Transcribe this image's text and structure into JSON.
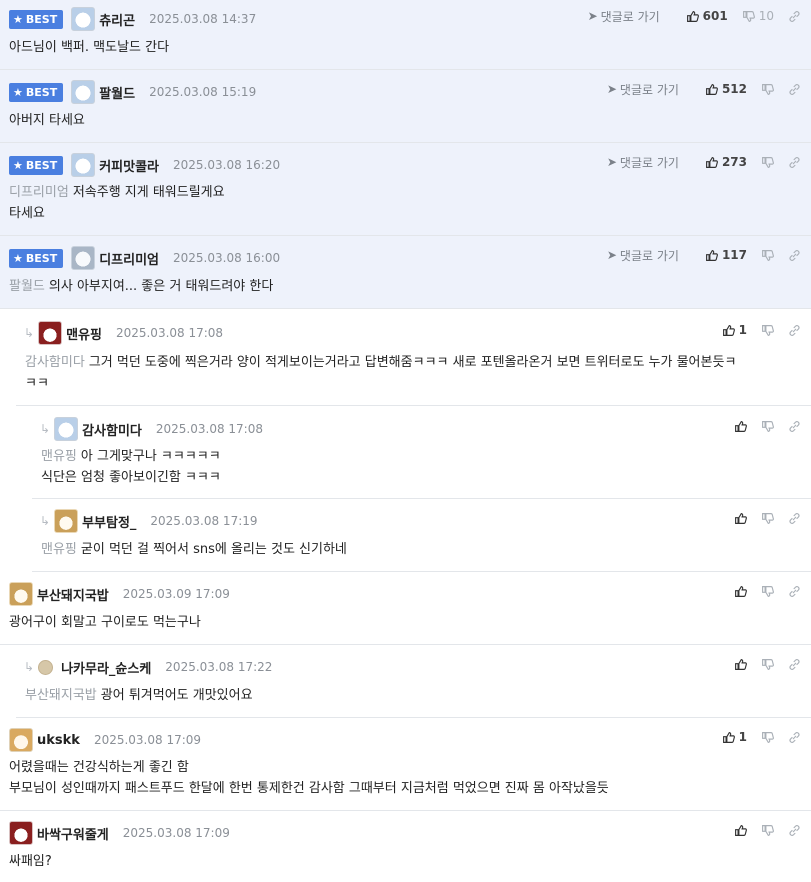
{
  "labels": {
    "best": "BEST",
    "goto": "댓글로 가기"
  },
  "comments": [
    {
      "nick": "츄리곤",
      "date": "2025.03.08 14:37",
      "likes": "601",
      "dislikes": "10",
      "text": "아드님이 백퍼. 맥도날드 간다"
    },
    {
      "nick": "팔월드",
      "date": "2025.03.08 15:19",
      "likes": "512",
      "text": "아버지 타세요"
    },
    {
      "nick": "커피맛콜라",
      "date": "2025.03.08 16:20",
      "likes": "273",
      "mention": "디프리미엄",
      "text": "저속주행 지게 태워드릴게요",
      "text2": "타세요"
    },
    {
      "nick": "디프리미엄",
      "date": "2025.03.08 16:00",
      "likes": "117",
      "mention": "팔월드",
      "text": "의사 아부지여... 좋은 거 태워드려야 한다"
    },
    {
      "nick": "맨유핑",
      "date": "2025.03.08 17:08",
      "likes": "1",
      "mention": "감사함미다",
      "text": "그거 먹던 도중에 찍은거라 양이 적게보이는거라고 답변해줌ㅋㅋㅋ 새로 포텐올라온거 보면 트위터로도 누가 물어본듯ㅋ",
      "text2": "ㅋㅋ"
    },
    {
      "nick": "감사함미다",
      "date": "2025.03.08 17:08",
      "mention": "맨유핑",
      "text": "아 그게맞구나 ㅋㅋㅋㅋㅋ",
      "text2": "식단은 엄청 좋아보이긴함 ㅋㅋㅋ"
    },
    {
      "nick": "부부탐정_",
      "date": "2025.03.08 17:19",
      "mention": "맨유핑",
      "text": "굳이 먹던 걸 찍어서 sns에 올리는 것도 신기하네"
    },
    {
      "nick": "부산돼지국밥",
      "date": "2025.03.09 17:09",
      "text": "광어구이 회말고 구이로도 먹는구나"
    },
    {
      "nick": "나카무라_슌스케",
      "date": "2025.03.08 17:22",
      "mention": "부산돼지국밥",
      "text": "광어 튀겨먹어도 개맛있어요"
    },
    {
      "nick": "ukskk",
      "date": "2025.03.08 17:09",
      "likes": "1",
      "text": "어렸을때는 건강식하는게 좋긴 함",
      "text2": "부모님이 성인때까지 패스트푸드 한달에 한번 통제한건 감사함 그때부터 지금처럼 먹었으면 진짜 몸 아작났을듯"
    },
    {
      "nick": "바싹구워줄게",
      "date": "2025.03.08 17:09",
      "text": "싸패임?"
    }
  ]
}
